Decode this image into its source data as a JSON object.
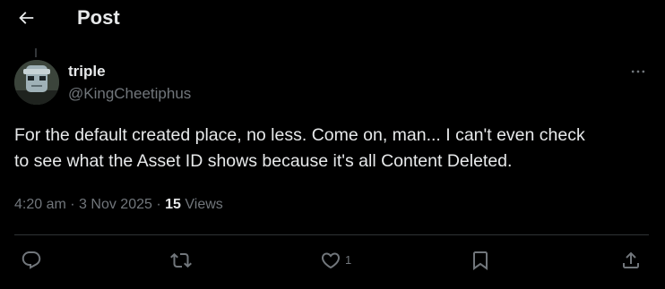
{
  "header": {
    "title": "Post",
    "back_icon": "arrow-left-icon"
  },
  "post": {
    "author": {
      "display_name": "triple",
      "handle": "@KingCheetiphus",
      "avatar_icon": "avatar-image"
    },
    "text": "For the default created place, no less. Come on, man... I can't even check\nto see what the Asset ID shows because it's all Content Deleted.",
    "time": "4:20 am",
    "date": "3 Nov 2025",
    "separator": "·",
    "views_count": "15",
    "views_label": "Views",
    "more_icon": "more-horizontal-icon"
  },
  "actions": {
    "reply_icon": "reply-icon",
    "repost_icon": "repost-icon",
    "like_icon": "heart-icon",
    "like_count": "1",
    "bookmark_icon": "bookmark-icon",
    "share_icon": "share-icon"
  },
  "colors": {
    "background": "#000000",
    "text_primary": "#e7e9ea",
    "text_secondary": "#71767b",
    "divider": "#2f3336"
  }
}
